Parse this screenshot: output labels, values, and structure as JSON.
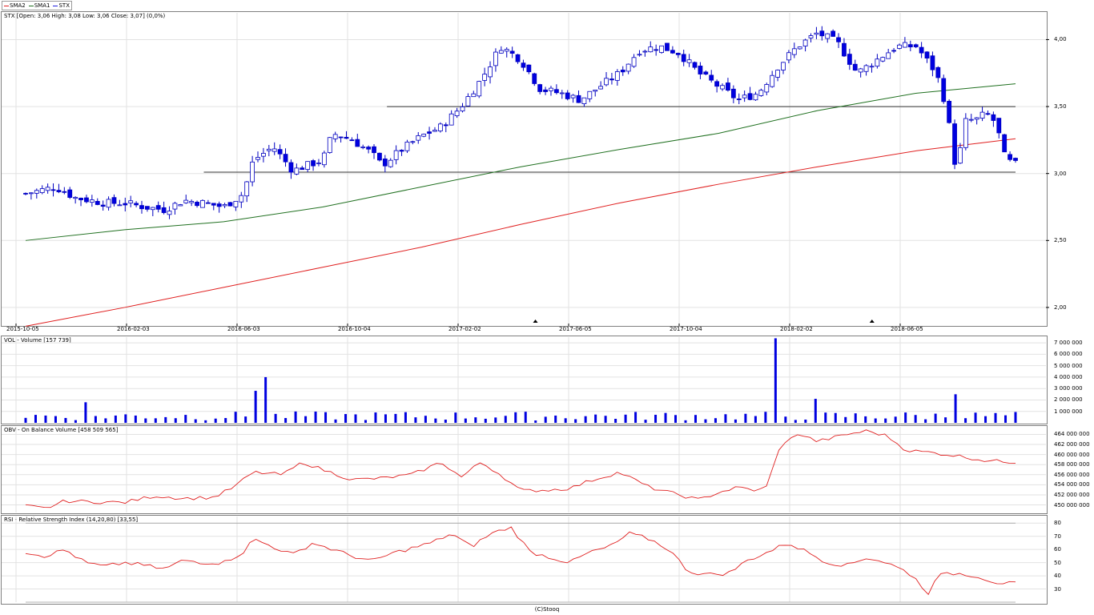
{
  "legend": [
    {
      "label": "SMA2",
      "color": "#e02020"
    },
    {
      "label": "SMA1",
      "color": "#207020"
    },
    {
      "label": "STX",
      "color": "#2020e0"
    }
  ],
  "colors": {
    "candle_down": "#0000e0",
    "candle_up_fill": "#ffffff",
    "candle_up_stroke": "#0000c0",
    "sma2": "#e02020",
    "sma1": "#207020",
    "grid": "#e2e2e2",
    "level": "#333333",
    "volume": "#0000e0",
    "obv": "#e02020",
    "rsi": "#e02020"
  },
  "panels": {
    "price": {
      "title": "STX [Open: 3,06  High: 3,08  Low: 3,06  Close: 3,07] (0,0%)"
    },
    "volume": {
      "title": "VOL - Volume [157 739]"
    },
    "obv": {
      "title": "OBV - On Balance Volume [458 509 565]"
    },
    "rsi": {
      "title": "RSI - Relative Strength Index (14,20,80) [33,55]"
    }
  },
  "footer": "(C)Stooq",
  "chart_data": [
    {
      "type": "candlestick",
      "name": "STX",
      "x_labels": [
        "2015-10-05",
        "2016-02-03",
        "2016-06-03",
        "2016-10-04",
        "2017-02-02",
        "2017-06-05",
        "2017-10-04",
        "2018-02-02",
        "2018-06-05"
      ],
      "x_range": [
        0,
        1
      ],
      "y_ticks": [
        "4,00",
        "3,50",
        "3,00",
        "2,50",
        "2,00"
      ],
      "y_tick_values": [
        4.0,
        3.5,
        3.0,
        2.5,
        2.0
      ],
      "ylim": [
        1.88,
        4.2
      ],
      "horizontal_levels": [
        {
          "y": 3.5,
          "from": 0.365,
          "to": 1.0
        },
        {
          "y": 3.01,
          "from": 0.18,
          "to": 1.0
        }
      ],
      "close_path": [
        [
          0.0,
          2.85
        ],
        [
          0.03,
          2.9
        ],
        [
          0.05,
          2.82
        ],
        [
          0.08,
          2.78
        ],
        [
          0.1,
          2.78
        ],
        [
          0.12,
          2.75
        ],
        [
          0.14,
          2.73
        ],
        [
          0.16,
          2.8
        ],
        [
          0.18,
          2.78
        ],
        [
          0.2,
          2.75
        ],
        [
          0.22,
          2.85
        ],
        [
          0.23,
          3.1
        ],
        [
          0.25,
          3.2
        ],
        [
          0.27,
          3.02
        ],
        [
          0.28,
          3.05
        ],
        [
          0.3,
          3.1
        ],
        [
          0.31,
          3.3
        ],
        [
          0.33,
          3.25
        ],
        [
          0.35,
          3.15
        ],
        [
          0.36,
          3.06
        ],
        [
          0.38,
          3.18
        ],
        [
          0.4,
          3.28
        ],
        [
          0.42,
          3.35
        ],
        [
          0.44,
          3.5
        ],
        [
          0.46,
          3.7
        ],
        [
          0.48,
          3.95
        ],
        [
          0.5,
          3.85
        ],
        [
          0.52,
          3.63
        ],
        [
          0.54,
          3.6
        ],
        [
          0.56,
          3.55
        ],
        [
          0.58,
          3.65
        ],
        [
          0.6,
          3.75
        ],
        [
          0.62,
          3.92
        ],
        [
          0.64,
          3.95
        ],
        [
          0.66,
          3.9
        ],
        [
          0.68,
          3.75
        ],
        [
          0.7,
          3.65
        ],
        [
          0.72,
          3.55
        ],
        [
          0.74,
          3.6
        ],
        [
          0.76,
          3.8
        ],
        [
          0.78,
          3.95
        ],
        [
          0.8,
          4.05
        ],
        [
          0.82,
          3.98
        ],
        [
          0.84,
          3.75
        ],
        [
          0.86,
          3.85
        ],
        [
          0.88,
          3.95
        ],
        [
          0.9,
          3.95
        ],
        [
          0.92,
          3.75
        ],
        [
          0.93,
          3.5
        ],
        [
          0.94,
          3.02
        ],
        [
          0.95,
          3.4
        ],
        [
          0.96,
          3.4
        ],
        [
          0.97,
          3.45
        ],
        [
          0.98,
          3.38
        ],
        [
          0.99,
          3.1
        ],
        [
          1.0,
          3.07
        ]
      ],
      "series": [
        {
          "name": "SMA1",
          "values": [
            [
              0.0,
              2.5
            ],
            [
              0.1,
              2.58
            ],
            [
              0.2,
              2.64
            ],
            [
              0.3,
              2.75
            ],
            [
              0.4,
              2.9
            ],
            [
              0.5,
              3.05
            ],
            [
              0.6,
              3.18
            ],
            [
              0.7,
              3.3
            ],
            [
              0.8,
              3.47
            ],
            [
              0.9,
              3.6
            ],
            [
              1.0,
              3.67
            ]
          ]
        },
        {
          "name": "SMA2",
          "values": [
            [
              0.0,
              1.86
            ],
            [
              0.1,
              2.0
            ],
            [
              0.2,
              2.15
            ],
            [
              0.3,
              2.3
            ],
            [
              0.4,
              2.45
            ],
            [
              0.5,
              2.62
            ],
            [
              0.6,
              2.78
            ],
            [
              0.7,
              2.92
            ],
            [
              0.8,
              3.05
            ],
            [
              0.9,
              3.17
            ],
            [
              1.0,
              3.26
            ]
          ]
        }
      ]
    },
    {
      "type": "bar",
      "name": "VOL - Volume",
      "y_ticks": [
        "7 000 000",
        "6 000 000",
        "5 000 000",
        "4 000 000",
        "3 000 000",
        "2 000 000",
        "1 000 000"
      ],
      "ylim": [
        0,
        7500000
      ],
      "peaks": [
        {
          "x": 0.06,
          "value": 1800000
        },
        {
          "x": 0.23,
          "value": 2800000
        },
        {
          "x": 0.24,
          "value": 4000000
        },
        {
          "x": 0.76,
          "value": 7400000
        },
        {
          "x": 0.8,
          "value": 2100000
        },
        {
          "x": 0.94,
          "value": 2500000
        }
      ],
      "base_value": 500000
    },
    {
      "type": "line",
      "name": "OBV - On Balance Volume",
      "y_ticks": [
        "464 000 000",
        "462 000 000",
        "460 000 000",
        "458 000 000",
        "456 000 000",
        "454 000 000",
        "452 000 000",
        "450 000 000"
      ],
      "ylim": [
        448500000,
        465500000
      ],
      "values": [
        [
          0.0,
          449800000
        ],
        [
          0.02,
          449300000
        ],
        [
          0.04,
          450800000
        ],
        [
          0.07,
          450600000
        ],
        [
          0.1,
          450500000
        ],
        [
          0.13,
          451800000
        ],
        [
          0.16,
          451300000
        ],
        [
          0.19,
          451500000
        ],
        [
          0.21,
          453500000
        ],
        [
          0.23,
          456500000
        ],
        [
          0.26,
          456000000
        ],
        [
          0.28,
          458500000
        ],
        [
          0.3,
          457000000
        ],
        [
          0.33,
          455000000
        ],
        [
          0.36,
          455300000
        ],
        [
          0.39,
          456000000
        ],
        [
          0.42,
          458500000
        ],
        [
          0.44,
          455500000
        ],
        [
          0.46,
          458500000
        ],
        [
          0.48,
          456000000
        ],
        [
          0.5,
          452800000
        ],
        [
          0.53,
          453000000
        ],
        [
          0.55,
          453300000
        ],
        [
          0.57,
          454800000
        ],
        [
          0.6,
          456500000
        ],
        [
          0.63,
          453500000
        ],
        [
          0.66,
          452000000
        ],
        [
          0.68,
          451000000
        ],
        [
          0.7,
          452500000
        ],
        [
          0.72,
          453500000
        ],
        [
          0.74,
          452800000
        ],
        [
          0.75,
          453800000
        ],
        [
          0.76,
          461000000
        ],
        [
          0.78,
          464200000
        ],
        [
          0.8,
          462600000
        ],
        [
          0.83,
          464000000
        ],
        [
          0.85,
          464700000
        ],
        [
          0.87,
          463700000
        ],
        [
          0.89,
          460800000
        ],
        [
          0.91,
          460500000
        ],
        [
          0.94,
          459800000
        ],
        [
          0.97,
          458800000
        ],
        [
          1.0,
          458500000
        ]
      ]
    },
    {
      "type": "line",
      "name": "RSI - Relative Strength Index",
      "y_ticks": [
        "80",
        "70",
        "60",
        "50",
        "40",
        "30"
      ],
      "ylim": [
        20,
        85
      ],
      "values": [
        [
          0.0,
          58
        ],
        [
          0.02,
          55
        ],
        [
          0.04,
          60
        ],
        [
          0.06,
          50
        ],
        [
          0.08,
          47
        ],
        [
          0.1,
          50
        ],
        [
          0.12,
          48
        ],
        [
          0.14,
          45
        ],
        [
          0.16,
          52
        ],
        [
          0.18,
          50
        ],
        [
          0.2,
          50
        ],
        [
          0.22,
          58
        ],
        [
          0.23,
          68
        ],
        [
          0.25,
          62
        ],
        [
          0.27,
          56
        ],
        [
          0.29,
          65
        ],
        [
          0.31,
          60
        ],
        [
          0.33,
          55
        ],
        [
          0.35,
          51
        ],
        [
          0.37,
          57
        ],
        [
          0.39,
          61
        ],
        [
          0.41,
          65
        ],
        [
          0.43,
          72
        ],
        [
          0.45,
          62
        ],
        [
          0.47,
          72
        ],
        [
          0.49,
          77
        ],
        [
          0.51,
          58
        ],
        [
          0.53,
          54
        ],
        [
          0.55,
          50
        ],
        [
          0.57,
          58
        ],
        [
          0.59,
          62
        ],
        [
          0.61,
          72
        ],
        [
          0.63,
          68
        ],
        [
          0.65,
          60
        ],
        [
          0.67,
          43
        ],
        [
          0.69,
          41
        ],
        [
          0.71,
          42
        ],
        [
          0.73,
          52
        ],
        [
          0.75,
          58
        ],
        [
          0.77,
          65
        ],
        [
          0.79,
          58
        ],
        [
          0.81,
          50
        ],
        [
          0.83,
          48
        ],
        [
          0.85,
          54
        ],
        [
          0.87,
          50
        ],
        [
          0.89,
          43
        ],
        [
          0.9,
          38
        ],
        [
          0.91,
          24
        ],
        [
          0.92,
          40
        ],
        [
          0.94,
          42
        ],
        [
          0.96,
          40
        ],
        [
          0.98,
          35
        ],
        [
          1.0,
          34
        ]
      ]
    }
  ]
}
